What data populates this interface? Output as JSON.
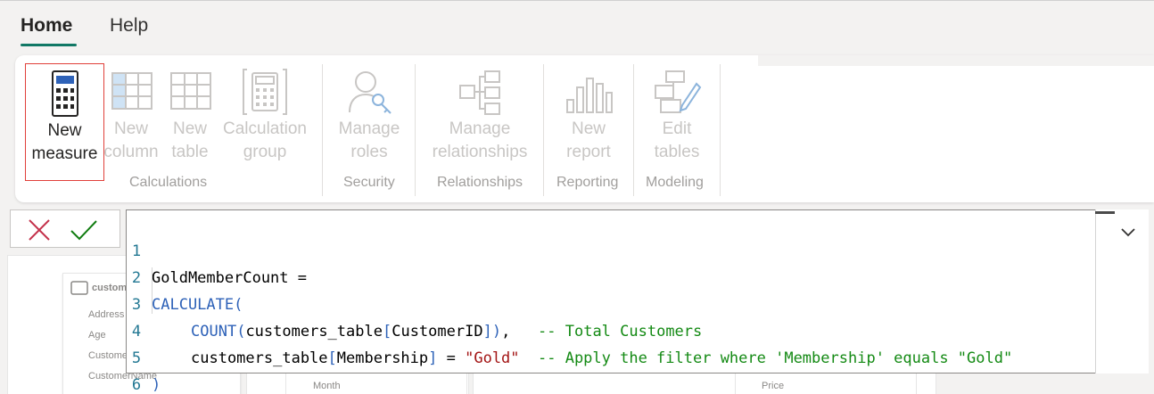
{
  "menu": {
    "tabs": [
      {
        "label": "Home"
      },
      {
        "label": "Help"
      }
    ]
  },
  "ribbon": {
    "buttons": [
      {
        "label": "New\nmeasure",
        "icon": "calculator-icon"
      },
      {
        "label": "New\ncolumn",
        "icon": "column-grid-icon"
      },
      {
        "label": "New\ntable",
        "icon": "table-grid-icon"
      },
      {
        "label": "Calculation\ngroup",
        "icon": "calculation-group-icon"
      },
      {
        "label": "Manage\nroles",
        "icon": "user-key-icon"
      },
      {
        "label": "Manage\nrelationships",
        "icon": "relationships-icon"
      },
      {
        "label": "New\nreport",
        "icon": "bar-chart-icon"
      },
      {
        "label": "Edit\ntables",
        "icon": "edit-tables-icon"
      }
    ],
    "groups": [
      {
        "label": "Calculations"
      },
      {
        "label": "Security"
      },
      {
        "label": "Relationships"
      },
      {
        "label": "Reporting"
      },
      {
        "label": "Modeling"
      }
    ]
  },
  "formula_bar": {
    "line_numbers": [
      "1",
      "2",
      "3",
      "4",
      "5",
      "6"
    ],
    "lines": {
      "l1": "GoldMemberCount =",
      "l2_kw": "CALCULATE",
      "l2_br": "(",
      "l3_kw": "COUNT",
      "l3_open": "(",
      "l3_ref": "customers_table",
      "l3_col_open": "[",
      "l3_col": "CustomerID",
      "l3_col_close": "]",
      "l3_close": ")",
      "l3_comma": ",   ",
      "l3_cmt": "-- Total Customers",
      "l4_ref": "customers_table",
      "l4_col_open": "[",
      "l4_col": "Membership",
      "l4_col_close": "]",
      "l4_eq": " = ",
      "l4_str": "\"Gold\"",
      "l4_cmt": "  -- Apply the filter where 'Membership' equals \"Gold\"",
      "l5": ")"
    }
  },
  "canvas": {
    "card_title": "custom",
    "fields": [
      "Address",
      "Age",
      "Custome",
      "CustomerName"
    ],
    "month_label": "Month",
    "price_label": "Price"
  },
  "colors": {
    "accent": "#117865",
    "selection_outline": "#e0403a",
    "cancel": "#c4314b",
    "commit": "#107c10"
  }
}
